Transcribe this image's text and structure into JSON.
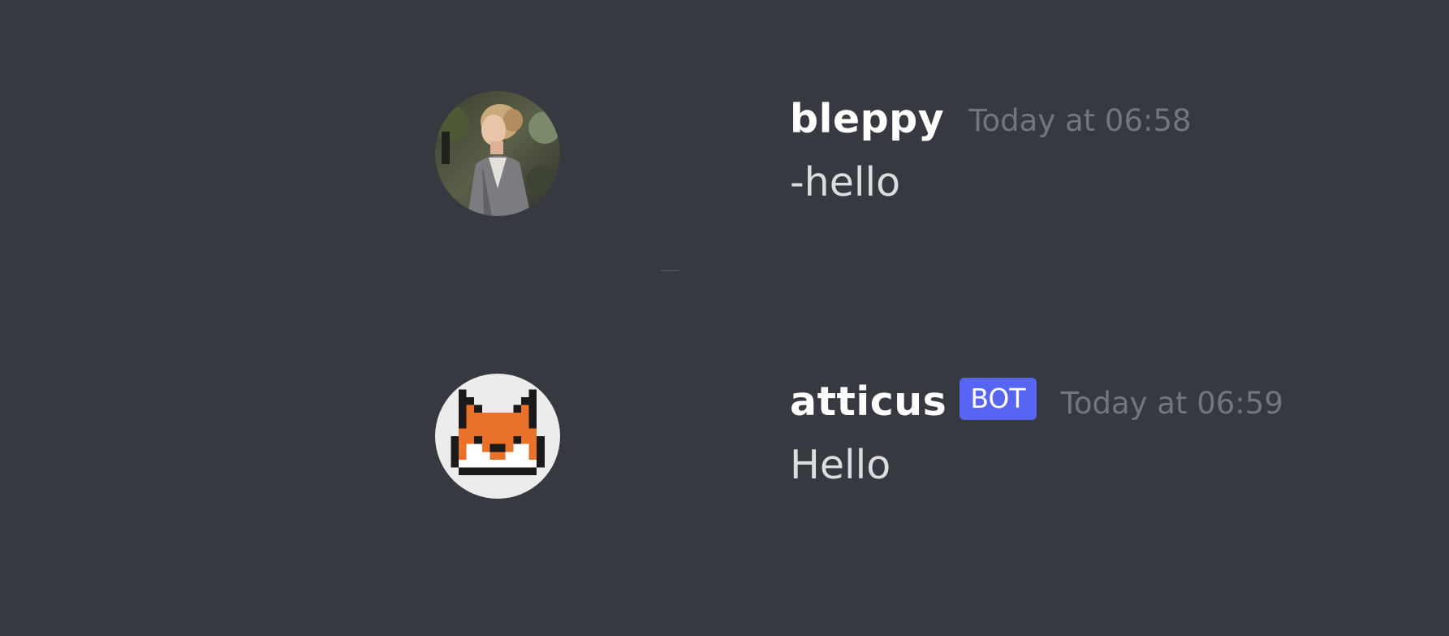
{
  "colors": {
    "background": "#36393f",
    "username": "#ffffff",
    "message_text": "#dcddde",
    "timestamp": "#72767d",
    "bot_badge": "#5865f2"
  },
  "messages": [
    {
      "username": "bleppy",
      "timestamp": "Today at 06:58",
      "text": "-hello",
      "avatar_icon": "user-photo-avatar",
      "is_bot": false
    },
    {
      "username": "atticus",
      "badge": "BOT",
      "timestamp": "Today at 06:59",
      "text": "Hello",
      "avatar_icon": "fox-pixel-avatar",
      "is_bot": true
    }
  ]
}
